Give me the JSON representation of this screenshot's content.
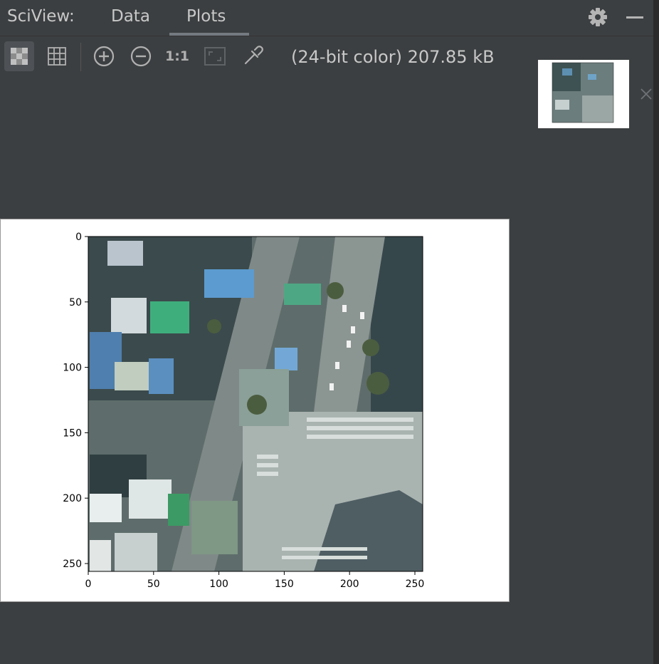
{
  "window": {
    "app_title": "SciView:",
    "tabs": [
      {
        "label": "Data",
        "active": false
      },
      {
        "label": "Plots",
        "active": true
      }
    ]
  },
  "toolbar": {
    "buttons": [
      {
        "name": "chessboard-toggle",
        "icon": "chessboard-icon",
        "active": true
      },
      {
        "name": "grid-toggle",
        "icon": "grid-icon",
        "active": false
      },
      {
        "name": "zoom-in",
        "icon": "zoom-in-icon"
      },
      {
        "name": "zoom-out",
        "icon": "zoom-out-icon"
      },
      {
        "name": "actual-size",
        "label": "1:1"
      },
      {
        "name": "fit-zoom",
        "icon": "fit-window-icon",
        "enabled": false
      },
      {
        "name": "color-picker",
        "icon": "eyedropper-icon"
      }
    ],
    "image_info": "(24-bit color) 207.85 kB"
  },
  "colors": {
    "panel_bg": "#3c3f41",
    "tab_underline": "#747a80",
    "plot_bg": "#ffffff"
  },
  "plot": {
    "x_ticks": [
      "0",
      "50",
      "100",
      "150",
      "200",
      "250"
    ],
    "y_ticks": [
      "0",
      "50",
      "100",
      "150",
      "200",
      "250"
    ],
    "image_content": "aerial photo of city block with buildings, intersection and crosswalks"
  },
  "chart_data": {
    "type": "heatmap",
    "title": "",
    "xlabel": "",
    "ylabel": "",
    "xlim": [
      0,
      256
    ],
    "ylim": [
      256,
      0
    ],
    "x_ticks": [
      0,
      50,
      100,
      150,
      200,
      250
    ],
    "y_ticks": [
      0,
      50,
      100,
      150,
      200,
      250
    ],
    "grid": false
  }
}
